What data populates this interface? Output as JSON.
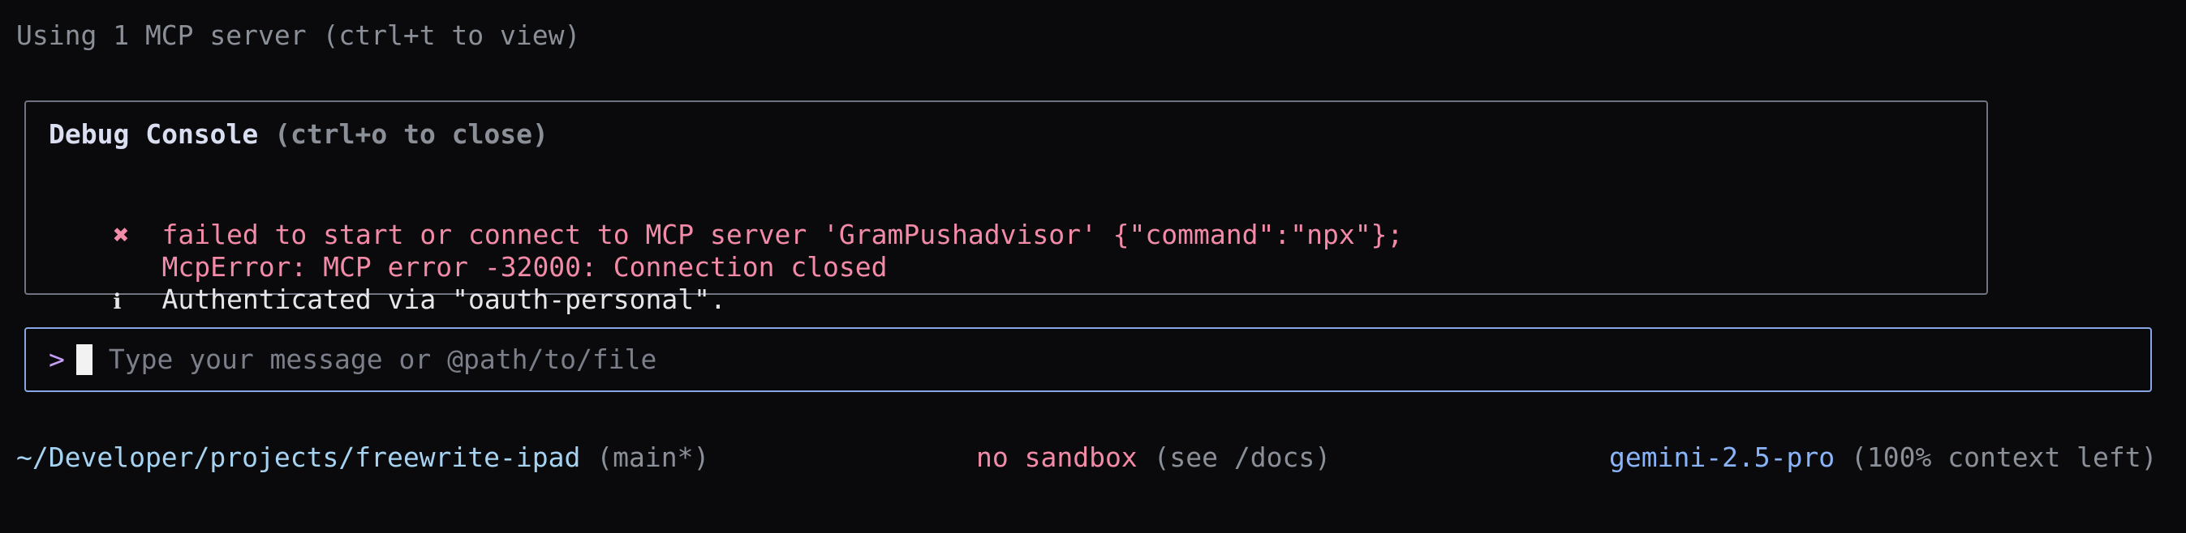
{
  "header": {
    "mcp_status": "Using 1 MCP server (ctrl+t to view)"
  },
  "debug_console": {
    "title": "Debug Console",
    "close_hint": "(ctrl+o to close)",
    "logs": [
      {
        "icon": "✖",
        "icon_name": "error-x-icon",
        "line1": "failed to start or connect to MCP server 'GramPushadvisor' {\"command\":\"npx\"};",
        "line2": "McpError: MCP error -32000: Connection closed"
      },
      {
        "icon": "ℹ",
        "icon_name": "info-icon",
        "line1": "Authenticated via \"oauth-personal\"."
      }
    ]
  },
  "input": {
    "prompt": ">",
    "placeholder": "Type your message or @path/to/file",
    "value": ""
  },
  "footer": {
    "path": "~/Developer/projects/freewrite-ipad",
    "branch": "(main*)",
    "sandbox": "no sandbox",
    "sandbox_hint": "(see /docs)",
    "model": "gemini-2.5-pro",
    "context": "(100% context left)"
  },
  "colors": {
    "background": "#0a0a0c",
    "error": "#f38ba8",
    "accent_border": "#89a7e6",
    "model": "#89b4fa",
    "path": "#a6d3f2",
    "muted": "#8a8f98"
  }
}
